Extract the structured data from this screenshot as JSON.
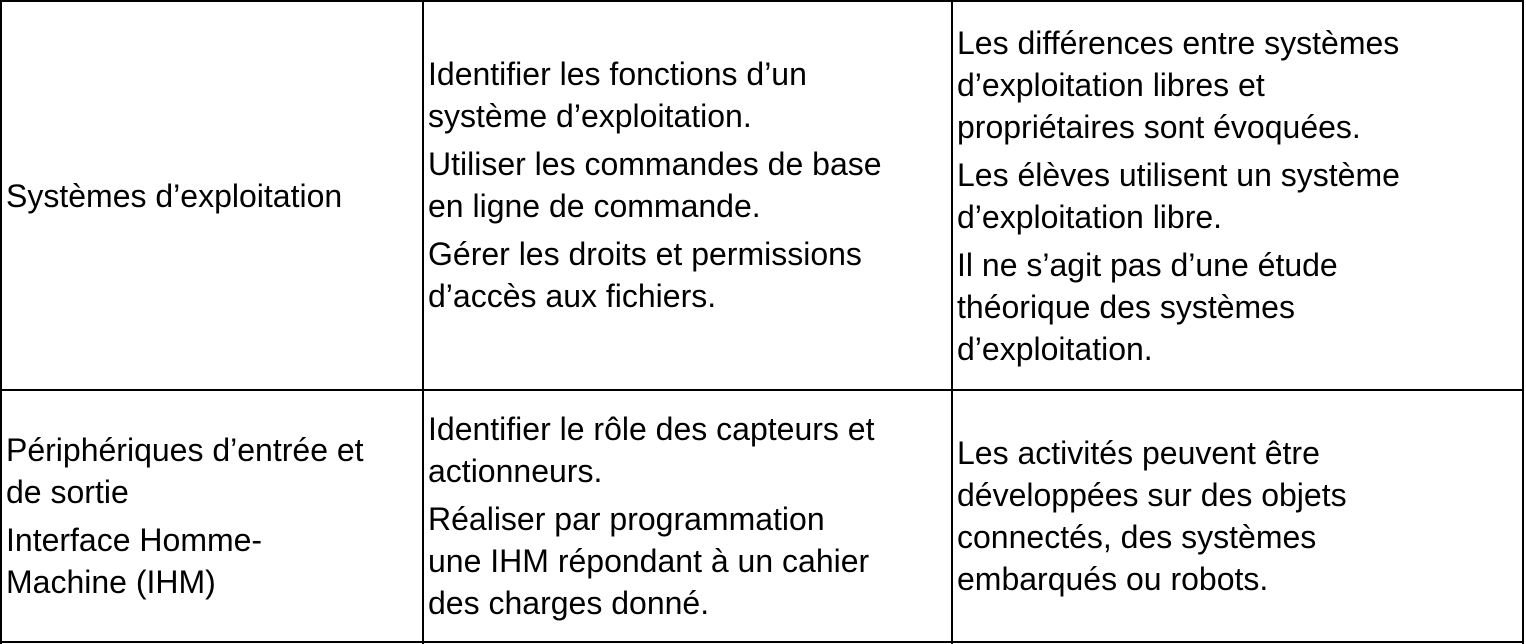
{
  "table": {
    "rows": [
      {
        "topic": [
          "Systèmes d’exploitation"
        ],
        "abilities": [
          [
            "Identifier les fonctions d’un",
            "système d’exploitation."
          ],
          [
            "Utiliser les commandes de base",
            "en ligne de commande."
          ],
          [
            "Gérer les droits et permissions",
            "d’accès aux fichiers."
          ]
        ],
        "comments": [
          [
            "Les différences entre systèmes",
            "d’exploitation libres et",
            "propriétaires sont évoquées."
          ],
          [
            "Les élèves utilisent un système",
            "d’exploitation libre."
          ],
          [
            "Il ne s’agit pas d’une étude",
            "théorique des systèmes",
            "d’exploitation."
          ]
        ]
      },
      {
        "topic": [
          [
            "Périphériques d’entrée et",
            "de sortie"
          ],
          [
            "Interface Homme-",
            "Machine (IHM)"
          ]
        ],
        "abilities": [
          [
            "Identifier le rôle des capteurs et",
            "actionneurs."
          ],
          [
            "Réaliser par programmation",
            "une IHM répondant à un cahier",
            "des charges donné."
          ]
        ],
        "comments": [
          [
            "Les activités peuvent être",
            "développées sur des objets",
            "connectés, des systèmes",
            "embarqués ou robots."
          ]
        ]
      }
    ]
  }
}
